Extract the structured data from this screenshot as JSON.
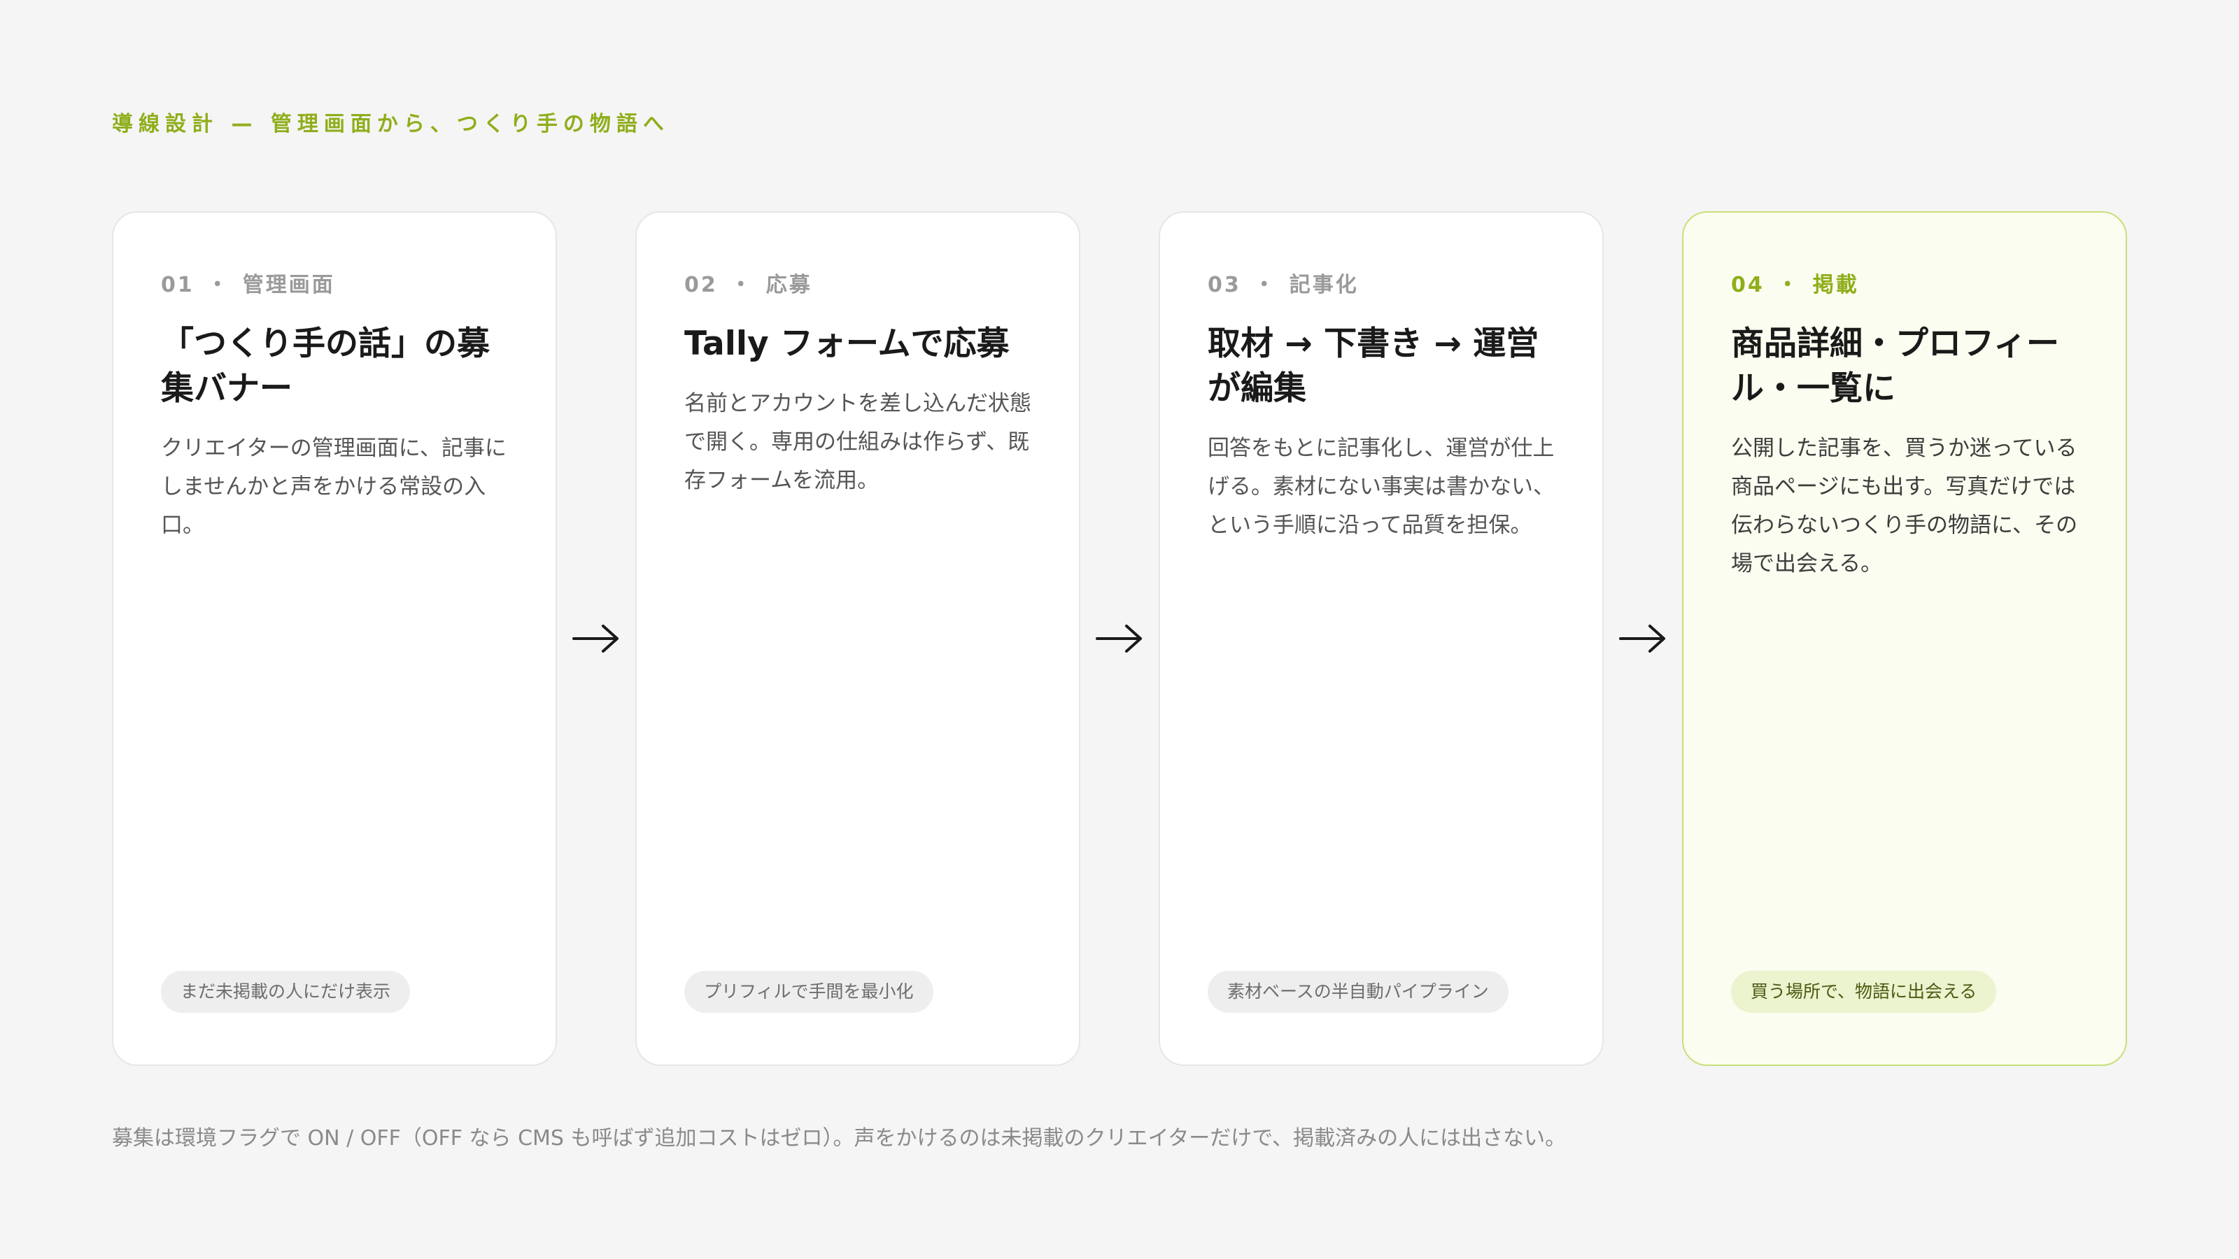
{
  "eyebrow": "導線設計 — 管理画面から、つくり手の物語へ",
  "steps": [
    {
      "number": "01",
      "dot": "・",
      "category": "管理画面",
      "title": "「つくり手の話」の募集バナー",
      "description": "クリエイターの管理画面に、記事にしませんかと声をかける常設の入口。",
      "tag": "まだ未掲載の人にだけ表示",
      "highlight": false
    },
    {
      "number": "02",
      "dot": "・",
      "category": "応募",
      "title": "Tally フォームで応募",
      "description": "名前とアカウントを差し込んだ状態で開く。専用の仕組みは作らず、既存フォームを流用。",
      "tag": "プリフィルで手間を最小化",
      "highlight": false
    },
    {
      "number": "03",
      "dot": "・",
      "category": "記事化",
      "title": "取材 → 下書き → 運営が編集",
      "description": "回答をもとに記事化し、運営が仕上げる。素材にない事実は書かない、という手順に沿って品質を担保。",
      "tag": "素材ベースの半自動パイプライン",
      "highlight": false
    },
    {
      "number": "04",
      "dot": "・",
      "category": "掲載",
      "title": "商品詳細・プロフィール・一覧に",
      "description": "公開した記事を、買うか迷っている商品ページにも出す。写真だけでは伝わらないつくり手の物語に、その場で出会える。",
      "tag": "買う場所で、物語に出会える",
      "highlight": true
    }
  ],
  "arrow_icon": "arrow-right-icon",
  "footnote": "募集は環境フラグで ON / OFF（OFF なら CMS も呼ばず追加コストはゼロ）。声をかけるのは未掲載のクリエイターだけで、掲載済みの人には出さない。",
  "colors": {
    "accent": "#8fae1b",
    "highlight_bg": "#fbfdf0",
    "highlight_border": "#c7df7b",
    "background": "#f5f5f5"
  }
}
